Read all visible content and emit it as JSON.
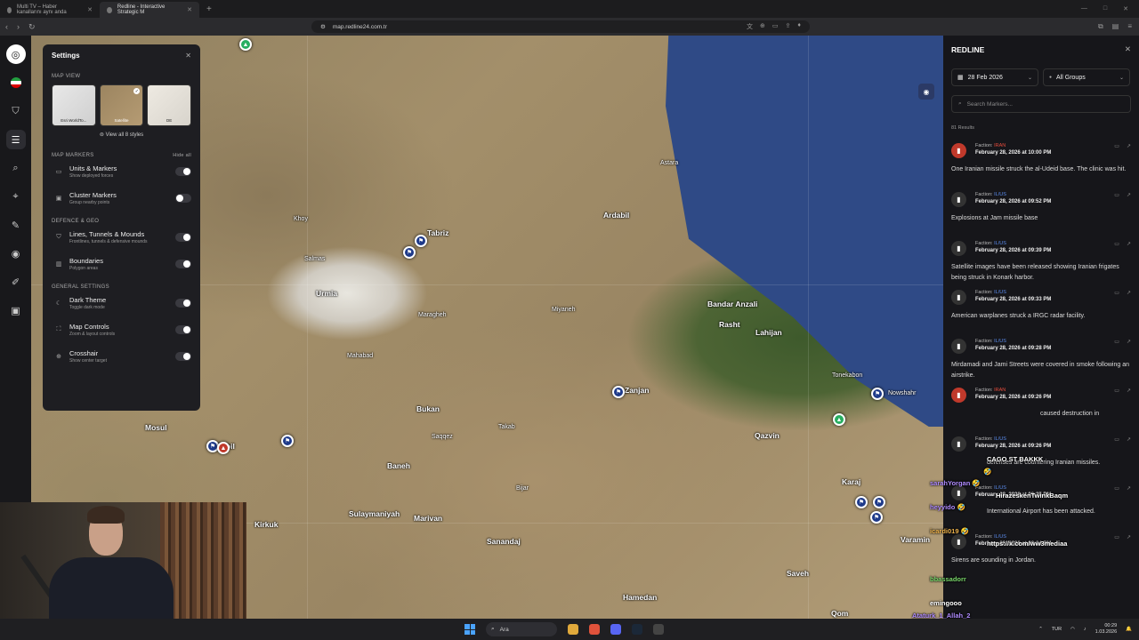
{
  "browser": {
    "tabs": [
      {
        "title": "Multi TV – Haber kanallarını aynı anda",
        "active": false
      },
      {
        "title": "Redline - Interactive Strategic M",
        "active": true
      }
    ],
    "url": "map.redline24.com.tr"
  },
  "settings": {
    "title": "Settings",
    "map_view": {
      "title": "MAP VIEW",
      "styles": [
        {
          "label": "Esri.WorldTo..."
        },
        {
          "label": "Satellite",
          "selected": true
        },
        {
          "label": "DE"
        }
      ],
      "view_all": "View all 8 styles"
    },
    "map_markers": {
      "title": "MAP MARKERS",
      "hide_all": "Hide all",
      "items": [
        {
          "label": "Units & Markers",
          "sub": "Show deployed forces",
          "on": true
        },
        {
          "label": "Cluster Markers",
          "sub": "Group nearby points",
          "on": false
        }
      ]
    },
    "defence": {
      "title": "DEFENCE & GEO",
      "items": [
        {
          "label": "Lines, Tunnels & Mounds",
          "sub": "Frontlines, tunnels & defensive mounds",
          "on": true
        },
        {
          "label": "Boundaries",
          "sub": "Polygon areas",
          "on": true
        }
      ]
    },
    "general": {
      "title": "GENERAL SETTINGS",
      "items": [
        {
          "label": "Dark Theme",
          "sub": "Toggle dark mode",
          "on": true
        },
        {
          "label": "Map Controls",
          "sub": "Zoom & layout controls",
          "on": true
        },
        {
          "label": "Crosshair",
          "sub": "Show center target",
          "on": true
        }
      ]
    }
  },
  "map": {
    "cities": [
      "Tabriz",
      "Ardabil",
      "Urmia",
      "Bandar Anzali",
      "Rasht",
      "Lahijan",
      "Zanjan",
      "Qazvin",
      "Karaj",
      "Bukan",
      "Baneh",
      "Mosul",
      "Erbil",
      "Sulaymaniyah",
      "Marivan",
      "Sanandaj",
      "Kirkuk",
      "Hamedan",
      "Saveh",
      "Qom",
      "Varamin",
      "Tonekabon",
      "Nowshahr",
      "Astara",
      "Khoy",
      "Salmas",
      "Maragheh",
      "Miyaneh",
      "Mahabad",
      "Saqqez",
      "Takab",
      "Bijar"
    ]
  },
  "redline": {
    "title": "REDLINE",
    "date_filter": "28 Feb 2026",
    "group_filter": "All Groups",
    "search_placeholder": "Search Markers...",
    "results": "81 Results",
    "events": [
      {
        "faction_label": "Faction:",
        "faction": "IRAN",
        "date": "February 28, 2026 at 10:00 PM",
        "text": "One Iranian missile struck the al-Udeid base. The clinic was hit.",
        "icon_color": "red"
      },
      {
        "faction_label": "Faction:",
        "faction": "IL/US",
        "date": "February 28, 2026 at 09:52 PM",
        "text": "Explosions at Jam missile base",
        "icon_color": "dark"
      },
      {
        "faction_label": "Faction:",
        "faction": "IL/US",
        "date": "February 28, 2026 at 09:39 PM",
        "text": "Satellite images have been released showing Iranian frigates being struck in Konark harbor.",
        "icon_color": "dark"
      },
      {
        "faction_label": "Faction:",
        "faction": "IL/US",
        "date": "February 28, 2026 at 09:33 PM",
        "text": "American warplanes struck a IRGC radar facility.",
        "icon_color": "dark"
      },
      {
        "faction_label": "Faction:",
        "faction": "IL/US",
        "date": "February 28, 2026 at 09:28 PM",
        "text": "Mirdamadi and Jami Streets were covered in smoke following an airstrike.",
        "icon_color": "dark"
      },
      {
        "faction_label": "Faction:",
        "faction": "IRAN",
        "date": "February 28, 2026 at 09:26 PM",
        "text": "caused destruction in",
        "icon_color": "red"
      },
      {
        "faction_label": "Faction:",
        "faction": "IL/US",
        "date": "February 28, 2026 at 09:26 PM",
        "text": "defenses are countering Iranian missiles.",
        "icon_color": "dark"
      },
      {
        "faction_label": "Faction:",
        "faction": "IL/US",
        "date": "February 28, 2026 at 09:25 PM",
        "text": "International Airport has been attacked.",
        "icon_color": "dark"
      },
      {
        "faction_label": "Faction:",
        "faction": "IL/US",
        "date": "February 28, 2026 at 09:24 PM",
        "text": "Sirens are sounding in Jordan.",
        "icon_color": "dark"
      }
    ]
  },
  "chat": [
    {
      "user": "",
      "msg": "CAGO ST BAKKK"
    },
    {
      "user": "",
      "msg": "🤣"
    },
    {
      "user": "sarahYorgan",
      "msg": "🤣"
    },
    {
      "user": "",
      "msg": "HirazeskenTwinkBaqm"
    },
    {
      "user": "heyyido",
      "msg": "🤣"
    },
    {
      "user": "",
      "msg": ""
    },
    {
      "user": "icardi019",
      "msg": "🤣"
    },
    {
      "user": "",
      "msg": "https://x.com/ww3mediaa"
    },
    {
      "user": "",
      "msg": ""
    },
    {
      "user": "",
      "msg": ""
    },
    {
      "user": "bbassadorr",
      "msg": ""
    },
    {
      "user": "",
      "msg": ""
    },
    {
      "user": "",
      "msg": "emingooo"
    },
    {
      "user": "Ataturk_1_Allah_2",
      "msg": ""
    },
    {
      "user": "Harrryyyatterrr",
      "msg": ""
    }
  ],
  "taskbar": {
    "search": "Ara",
    "lang": "TUR",
    "time": "00:29",
    "date": "1.03.2026"
  }
}
